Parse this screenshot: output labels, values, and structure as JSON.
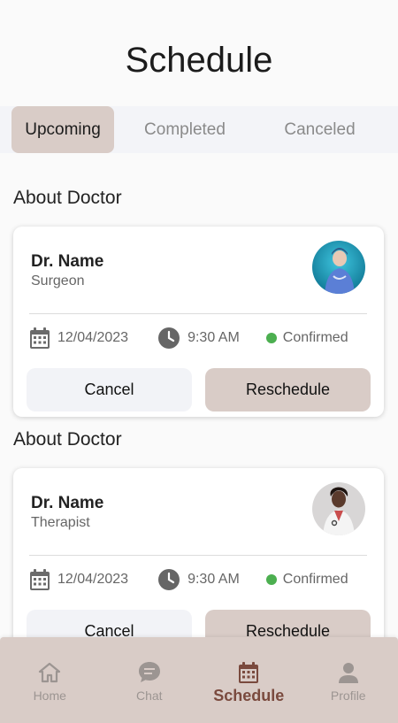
{
  "header": {
    "title": "Schedule"
  },
  "tabs": [
    {
      "label": "Upcoming",
      "active": true
    },
    {
      "label": "Completed",
      "active": false
    },
    {
      "label": "Canceled",
      "active": false
    }
  ],
  "appointments": [
    {
      "section_label": "About Doctor",
      "doctor_name": "Dr. Name",
      "specialty": "Surgeon",
      "date": "12/04/2023",
      "time": "9:30 AM",
      "status": "Confirmed",
      "cancel_label": "Cancel",
      "reschedule_label": "Reschedule"
    },
    {
      "section_label": "About Doctor",
      "doctor_name": "Dr. Name",
      "specialty": "Therapist",
      "date": "12/04/2023",
      "time": "9:30 AM",
      "status": "Confirmed",
      "cancel_label": "Cancel",
      "reschedule_label": "Reschedule"
    }
  ],
  "bottom_nav": [
    {
      "label": "Home",
      "icon": "home-icon",
      "active": false
    },
    {
      "label": "Chat",
      "icon": "chat-icon",
      "active": false
    },
    {
      "label": "Schedule",
      "icon": "calendar-icon",
      "active": true
    },
    {
      "label": "Profile",
      "icon": "person-icon",
      "active": false
    }
  ],
  "colors": {
    "accent": "#d9ccc7",
    "active_nav": "#7a4a3e",
    "status_confirmed": "#4caf50",
    "button_secondary": "#f2f3f7"
  }
}
